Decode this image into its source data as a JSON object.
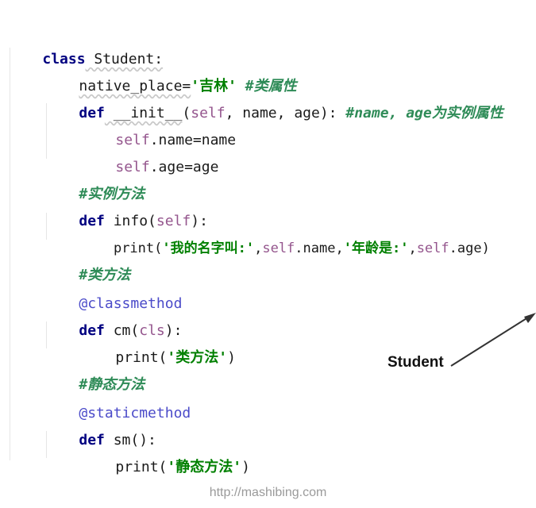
{
  "code": {
    "l1_class_kw": "class",
    "l1_rest": " Student:",
    "l2_name": "native_place=",
    "l2_str": "'吉林'",
    "l2_comment": "#类属性",
    "l3_def": "def",
    "l3_fn": " __init__",
    "l3_open": "(",
    "l3_self": "self",
    "l3_args": ", name, age):",
    "l3_comment": "#name, age为实例属性",
    "l4_self": "self",
    "l4_rest": ".name=name",
    "l5_self": "self",
    "l5_rest": ".age=age",
    "l6_comment": "#实例方法",
    "l7_def": "def",
    "l7_fn": " info(",
    "l7_self": "self",
    "l7_close": "):",
    "l8_print": "print(",
    "l8_str1": "'我的名字叫:'",
    "l8_comma1": ",",
    "l8_self1": "self",
    "l8_name": ".name,",
    "l8_str2": "'年龄是:'",
    "l8_comma2": ",",
    "l8_self2": "self",
    "l8_age": ".age)",
    "l9_comment": "#类方法",
    "l10_dec": "@classmethod",
    "l11_def": "def",
    "l11_fn": " cm(",
    "l11_cls": "cls",
    "l11_close": "):",
    "l12_print": "print(",
    "l12_str": "'类方法'",
    "l12_close": ")",
    "l13_comment": "#静态方法",
    "l14_dec": "@staticmethod",
    "l15_def": "def",
    "l15_rest": " sm():",
    "l16_print": "print(",
    "l16_str": "'静态方法'",
    "l16_close": ")"
  },
  "annotation": {
    "label": "Student"
  },
  "footer": {
    "url": "http://mashibing.com"
  }
}
